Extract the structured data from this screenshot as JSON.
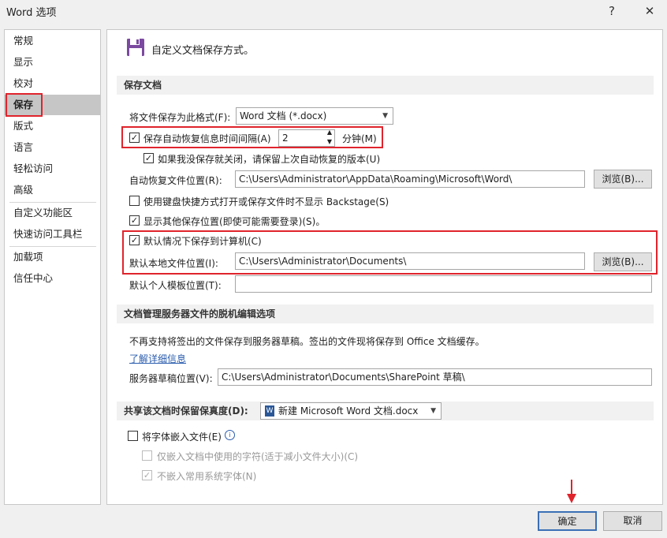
{
  "window": {
    "title": "Word 选项",
    "help_label": "?",
    "close_label": "✕"
  },
  "sidebar": {
    "items": [
      {
        "label": "常规"
      },
      {
        "label": "显示"
      },
      {
        "label": "校对"
      },
      {
        "label": "保存"
      },
      {
        "label": "版式"
      },
      {
        "label": "语言"
      },
      {
        "label": "轻松访问"
      },
      {
        "label": "高级"
      },
      {
        "label": "自定义功能区"
      },
      {
        "label": "快速访问工具栏"
      },
      {
        "label": "加载项"
      },
      {
        "label": "信任中心"
      }
    ]
  },
  "main": {
    "heading": "自定义文档保存方式。",
    "section_save": {
      "title": "保存文档",
      "format_label": "将文件保存为此格式(F):",
      "format_value": "Word 文档 (*.docx)",
      "autorecover_label": "保存自动恢复信息时间间隔(A)",
      "autorecover_value": "2",
      "minutes_label": "分钟(M)",
      "keep_last_label": "如果我没保存就关闭，请保留上次自动恢复的版本(U)",
      "autorecover_location_label": "自动恢复文件位置(R):",
      "autorecover_location_value": "C:\\Users\\Administrator\\AppData\\Roaming\\Microsoft\\Word\\",
      "browse_label": "浏览(B)...",
      "backstage_label": "使用键盘快捷方式打开或保存文件时不显示 Backstage(S)",
      "show_additional_label": "显示其他保存位置(即使可能需要登录)(S)。",
      "save_to_computer_label": "默认情况下保存到计算机(C)",
      "default_local_label": "默认本地文件位置(I):",
      "default_local_value": "C:\\Users\\Administrator\\Documents\\",
      "default_template_label": "默认个人模板位置(T):"
    },
    "section_offline": {
      "title": "文档管理服务器文件的脱机编辑选项",
      "info_text": "不再支持将签出的文件保存到服务器草稿。签出的文件现将保存到 Office 文档缓存。",
      "learn_more": "了解详细信息",
      "drafts_label": "服务器草稿位置(V):",
      "drafts_value": "C:\\Users\\Administrator\\Documents\\SharePoint 草稿\\"
    },
    "section_fidelity": {
      "title": "共享该文档时保留保真度(D):",
      "doc_value": "新建 Microsoft Word 文档.docx",
      "embed_fonts_label": "将字体嵌入文件(E)",
      "embed_used_only_label": "仅嵌入文档中使用的字符(适于减小文件大小)(C)",
      "no_common_fonts_label": "不嵌入常用系统字体(N)"
    }
  },
  "footer": {
    "ok_label": "确定",
    "cancel_label": "取消"
  },
  "colors": {
    "highlight": "#e0242c",
    "link": "#2a5cae",
    "nav_selected": "#c6c6c6"
  }
}
